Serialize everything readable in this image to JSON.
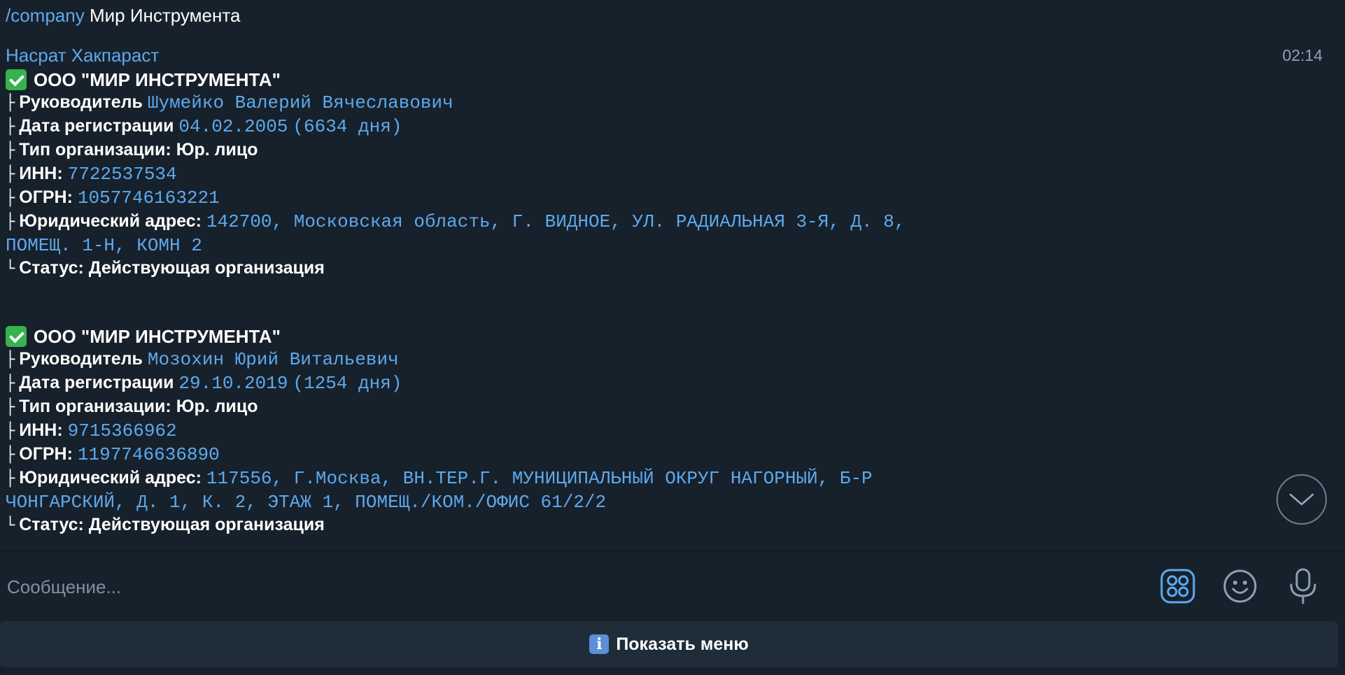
{
  "header": {
    "command": "/company",
    "query": "Мир Инструмента"
  },
  "message": {
    "author": "Насрат Хакпараст",
    "time": "02:14",
    "companies": [
      {
        "title": "ООО \"МИР ИНСТРУМЕНТА\"",
        "director_label": "Руководитель",
        "director": "Шумейко Валерий Вячеславович",
        "reg_label": "Дата регистрации",
        "reg_date": "04.02.2005",
        "reg_days": "(6634 дня)",
        "type_text": "Тип организации: Юр. лицо",
        "inn_label": "ИНН:",
        "inn": "7722537534",
        "ogrn_label": "ОГРН:",
        "ogrn": "1057746163221",
        "address_label": "Юридический адрес:",
        "address": "142700, Московская область, Г. ВИДНОЕ, УЛ. РАДИАЛЬНАЯ 3-Я, Д. 8, ПОМЕЩ. 1-Н, КОМН 2",
        "status_text": "Статус: Действующая организация"
      },
      {
        "title": "ООО \"МИР ИНСТРУМЕНТА\"",
        "director_label": "Руководитель",
        "director": "Мозохин Юрий Витальевич",
        "reg_label": "Дата регистрации",
        "reg_date": "29.10.2019",
        "reg_days": "(1254 дня)",
        "type_text": "Тип организации: Юр. лицо",
        "inn_label": "ИНН:",
        "inn": "9715366962",
        "ogrn_label": "ОГРН:",
        "ogrn": "1197746636890",
        "address_label": "Юридический адрес:",
        "address": "117556, Г.Москва, ВН.ТЕР.Г. МУНИЦИПАЛЬНЫЙ ОКРУГ НАГОРНЫЙ, Б-Р ЧОНГАРСКИЙ, Д. 1, К. 2, ЭТАЖ 1, ПОМЕЩ./КОМ./ОФИС 61/2/2",
        "status_text": "Статус: Действующая организация"
      }
    ]
  },
  "composer": {
    "placeholder": "Сообщение..."
  },
  "menu": {
    "label": "Показать меню"
  },
  "icons": {
    "verified": "check-mark-icon",
    "scroll_down": "chevron-down-icon",
    "bot_commands": "grid-icon",
    "emoji": "smile-icon",
    "microphone": "microphone-icon",
    "info": "info-icon"
  },
  "colors": {
    "background": "#17212b",
    "accent": "#5ea9ee",
    "menu_bar": "#1f2c3a",
    "check": "#37b24d"
  }
}
